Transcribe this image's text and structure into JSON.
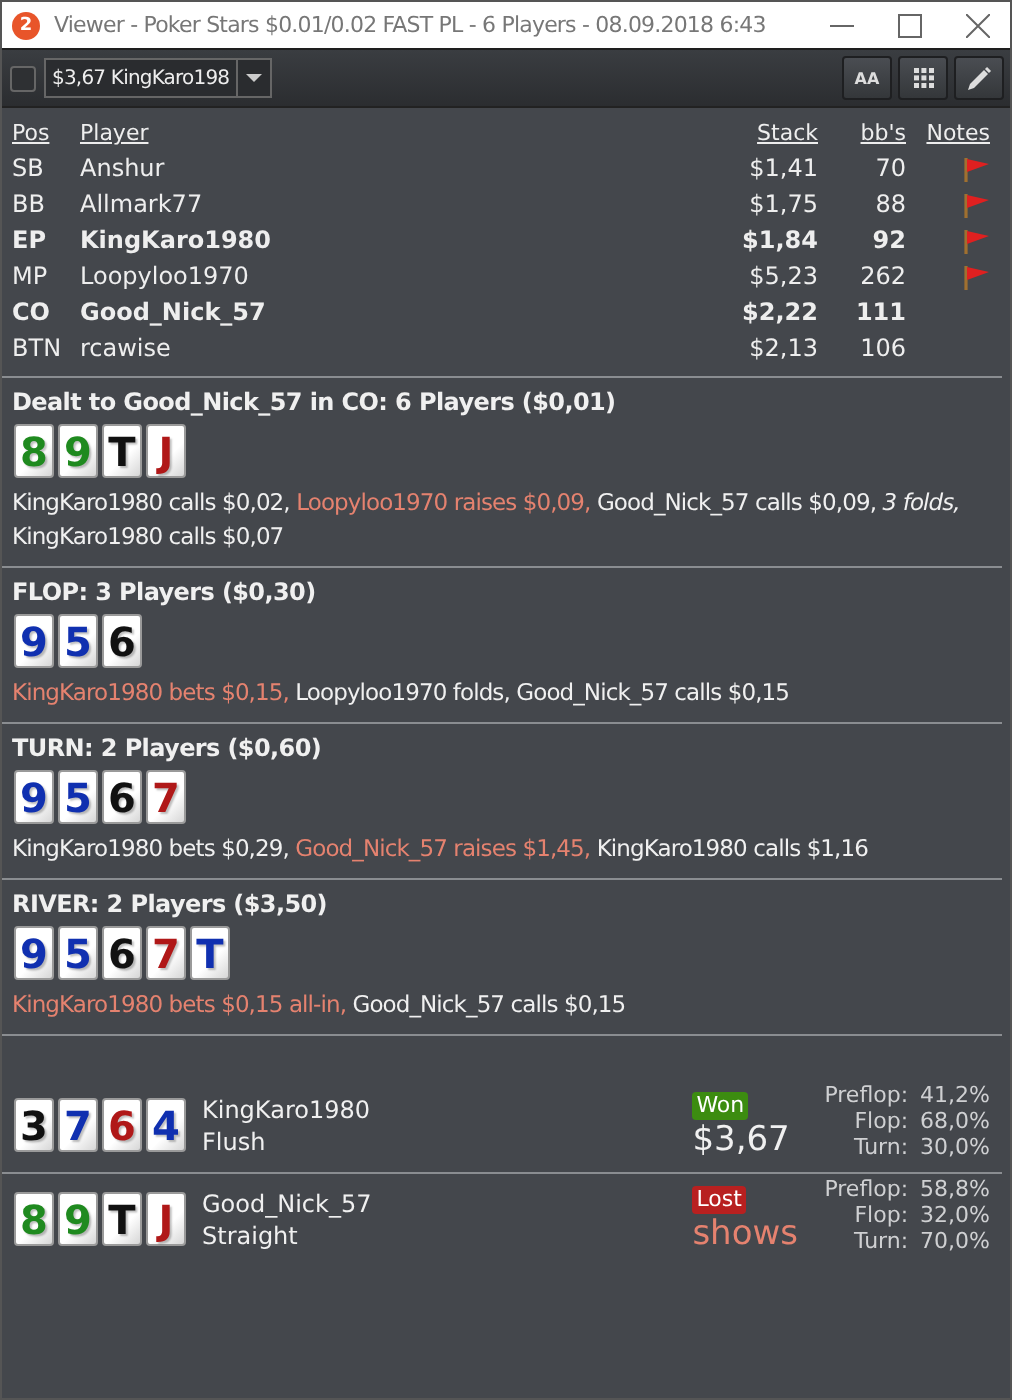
{
  "window": {
    "app_badge": "2",
    "title": "Viewer - Poker Stars $0.01/0.02 FAST PL - 6 Players - 08.09.2018 6:43"
  },
  "toolbar": {
    "checkbox": {
      "checked": false
    },
    "hand_select": {
      "value": "$3,67 KingKaro198"
    },
    "font_button": "AA"
  },
  "players": {
    "columns": [
      "Pos",
      "Player",
      "Stack",
      "bb's",
      "Notes"
    ],
    "rows": [
      {
        "pos": "SB",
        "player": "Anshur",
        "stack": "$1,41",
        "bbs": "70",
        "bold": false,
        "note": true
      },
      {
        "pos": "BB",
        "player": "Allmark77",
        "stack": "$1,75",
        "bbs": "88",
        "bold": false,
        "note": true
      },
      {
        "pos": "EP",
        "player": "KingKaro1980",
        "stack": "$1,84",
        "bbs": "92",
        "bold": true,
        "note": true
      },
      {
        "pos": "MP",
        "player": "Loopyloo1970",
        "stack": "$5,23",
        "bbs": "262",
        "bold": false,
        "note": true
      },
      {
        "pos": "CO",
        "player": "Good_Nick_57",
        "stack": "$2,22",
        "bbs": "111",
        "bold": true,
        "note": false
      },
      {
        "pos": "BTN",
        "player": "rcawise",
        "stack": "$2,13",
        "bbs": "106",
        "bold": false,
        "note": false
      }
    ]
  },
  "streets": [
    {
      "title": "Dealt to Good_Nick_57 in CO: 6 Players ($0,01)",
      "cards": [
        {
          "rank": "8",
          "color": "#1f8a1f"
        },
        {
          "rank": "9",
          "color": "#1f8a1f"
        },
        {
          "rank": "T",
          "color": "#111111"
        },
        {
          "rank": "J",
          "color": "#b01818"
        }
      ],
      "actions": [
        {
          "text": "KingKaro1980 calls $0,02,",
          "kind": "passive"
        },
        {
          "text": "Loopyloo1970 raises $0,09,",
          "kind": "aggressive"
        },
        {
          "text": "Good_Nick_57 calls $0,09,",
          "kind": "passive"
        },
        {
          "text": "3 folds,",
          "kind": "folds"
        },
        {
          "text": "KingKaro1980 calls $0,07",
          "kind": "passive"
        }
      ]
    },
    {
      "title": "FLOP: 3 Players ($0,30)",
      "cards": [
        {
          "rank": "9",
          "color": "#1030b0"
        },
        {
          "rank": "5",
          "color": "#1030b0"
        },
        {
          "rank": "6",
          "color": "#111111"
        }
      ],
      "actions": [
        {
          "text": "KingKaro1980 bets $0,15,",
          "kind": "aggressive"
        },
        {
          "text": "Loopyloo1970 folds,",
          "kind": "passive"
        },
        {
          "text": "Good_Nick_57 calls $0,15",
          "kind": "passive"
        }
      ]
    },
    {
      "title": "TURN: 2 Players ($0,60)",
      "cards": [
        {
          "rank": "9",
          "color": "#1030b0"
        },
        {
          "rank": "5",
          "color": "#1030b0"
        },
        {
          "rank": "6",
          "color": "#111111"
        },
        {
          "rank": "7",
          "color": "#b01818"
        }
      ],
      "actions": [
        {
          "text": "KingKaro1980 bets $0,29,",
          "kind": "passive"
        },
        {
          "text": "Good_Nick_57 raises $1,45,",
          "kind": "aggressive"
        },
        {
          "text": "KingKaro1980 calls $1,16",
          "kind": "passive"
        }
      ]
    },
    {
      "title": "RIVER: 2 Players ($3,50)",
      "cards": [
        {
          "rank": "9",
          "color": "#1030b0"
        },
        {
          "rank": "5",
          "color": "#1030b0"
        },
        {
          "rank": "6",
          "color": "#111111"
        },
        {
          "rank": "7",
          "color": "#b01818"
        },
        {
          "rank": "T",
          "color": "#1030b0"
        }
      ],
      "actions": [
        {
          "text": "KingKaro1980 bets $0,15 all-in,",
          "kind": "aggressive"
        },
        {
          "text": "Good_Nick_57 calls $0,15",
          "kind": "passive"
        }
      ]
    }
  ],
  "showdown": [
    {
      "cards": [
        {
          "rank": "3",
          "color": "#111111"
        },
        {
          "rank": "7",
          "color": "#1030b0"
        },
        {
          "rank": "6",
          "color": "#b01818"
        },
        {
          "rank": "4",
          "color": "#1030b0"
        }
      ],
      "player": "KingKaro1980",
      "hand": "Flush",
      "result": {
        "label": "Won",
        "kind": "won"
      },
      "amount": "$3,67",
      "equity": [
        {
          "label": "Preflop:",
          "value": "41,2%"
        },
        {
          "label": "Flop:",
          "value": "68,0%"
        },
        {
          "label": "Turn:",
          "value": "30,0%"
        }
      ]
    },
    {
      "cards": [
        {
          "rank": "8",
          "color": "#1f8a1f"
        },
        {
          "rank": "9",
          "color": "#1f8a1f"
        },
        {
          "rank": "T",
          "color": "#111111"
        },
        {
          "rank": "J",
          "color": "#b01818"
        }
      ],
      "player": "Good_Nick_57",
      "hand": "Straight",
      "result": {
        "label": "Lost",
        "kind": "lost"
      },
      "amount": "shows",
      "equity": [
        {
          "label": "Preflop:",
          "value": "58,8%"
        },
        {
          "label": "Flop:",
          "value": "32,0%"
        },
        {
          "label": "Turn:",
          "value": "70,0%"
        }
      ]
    }
  ]
}
